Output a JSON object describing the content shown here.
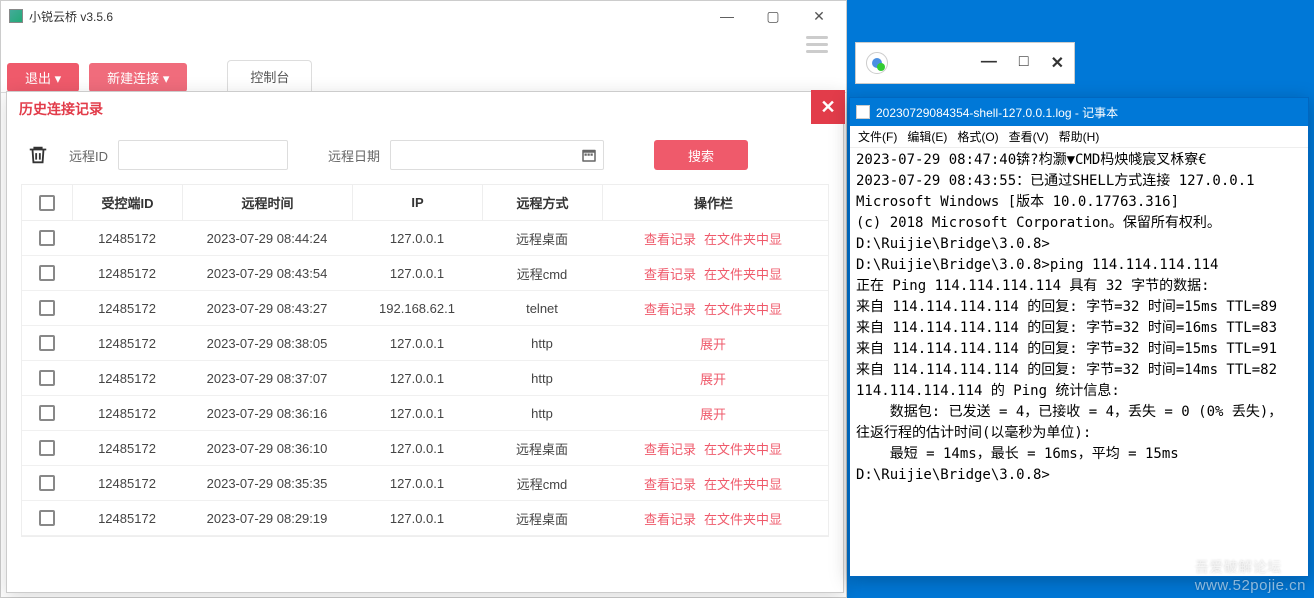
{
  "app": {
    "title": "小锐云桥 v3.5.6",
    "exit_btn": "退出",
    "new_btn": "新建连接",
    "console_tab": "控制台"
  },
  "modal": {
    "title": "历史连接记录",
    "remote_id_label": "远程ID",
    "remote_date_label": "远程日期",
    "search_btn": "搜索"
  },
  "grid": {
    "headers": {
      "id": "受控端ID",
      "time": "远程时间",
      "ip": "IP",
      "method": "远程方式",
      "ops": "操作栏"
    },
    "view_label": "查看记录",
    "folder_label": "在文件夹中显",
    "expand_label": "展开",
    "rows": [
      {
        "id": "12485172",
        "time": "2023-07-29 08:44:24",
        "ip": "127.0.0.1",
        "method": "远程桌面",
        "ops": "links"
      },
      {
        "id": "12485172",
        "time": "2023-07-29 08:43:54",
        "ip": "127.0.0.1",
        "method": "远程cmd",
        "ops": "links"
      },
      {
        "id": "12485172",
        "time": "2023-07-29 08:43:27",
        "ip": "192.168.62.1",
        "method": "telnet",
        "ops": "links"
      },
      {
        "id": "12485172",
        "time": "2023-07-29 08:38:05",
        "ip": "127.0.0.1",
        "method": "http",
        "ops": "expand"
      },
      {
        "id": "12485172",
        "time": "2023-07-29 08:37:07",
        "ip": "127.0.0.1",
        "method": "http",
        "ops": "expand"
      },
      {
        "id": "12485172",
        "time": "2023-07-29 08:36:16",
        "ip": "127.0.0.1",
        "method": "http",
        "ops": "expand"
      },
      {
        "id": "12485172",
        "time": "2023-07-29 08:36:10",
        "ip": "127.0.0.1",
        "method": "远程桌面",
        "ops": "links"
      },
      {
        "id": "12485172",
        "time": "2023-07-29 08:35:35",
        "ip": "127.0.0.1",
        "method": "远程cmd",
        "ops": "links"
      },
      {
        "id": "12485172",
        "time": "2023-07-29 08:29:19",
        "ip": "127.0.0.1",
        "method": "远程桌面",
        "ops": "links"
      }
    ]
  },
  "notepad": {
    "title": "20230729084354-shell-127.0.0.1.log - 记事本",
    "menu": {
      "file": "文件(F)",
      "edit": "编辑(E)",
      "format": "格式(O)",
      "view": "查看(V)",
      "help": "帮助(H)"
    },
    "body": "2023-07-29 08:47:40锛?枃灏▼CMD杩炴帴宸叉柇寮€\n2023-07-29 08:43:55：已通过SHELL方式连接 127.0.0.1\nMicrosoft Windows [版本 10.0.17763.316]\n(c) 2018 Microsoft Corporation。保留所有权利。\nD:\\Ruijie\\Bridge\\3.0.8>\nD:\\Ruijie\\Bridge\\3.0.8>ping 114.114.114.114\n正在 Ping 114.114.114.114 具有 32 字节的数据:\n来自 114.114.114.114 的回复: 字节=32 时间=15ms TTL=89\n来自 114.114.114.114 的回复: 字节=32 时间=16ms TTL=83\n来自 114.114.114.114 的回复: 字节=32 时间=15ms TTL=91\n来自 114.114.114.114 的回复: 字节=32 时间=14ms TTL=82\n114.114.114.114 的 Ping 统计信息:\n    数据包: 已发送 = 4，已接收 = 4，丢失 = 0 (0% 丢失)，\n往返行程的估计时间(以毫秒为单位):\n    最短 = 14ms，最长 = 16ms，平均 = 15ms\nD:\\Ruijie\\Bridge\\3.0.8>"
  },
  "watermark": {
    "cn": "吾爱破解论坛",
    "url": "www.52pojie.cn"
  }
}
